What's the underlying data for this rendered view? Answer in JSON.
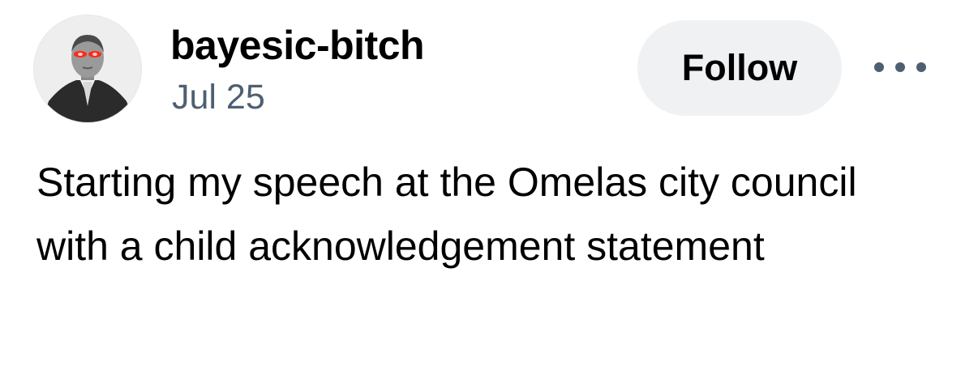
{
  "post": {
    "author": {
      "username": "bayesic-bitch",
      "avatar": "bayes-portrait-red-laser-eyes-avatar"
    },
    "date": "Jul 25",
    "follow_label": "Follow",
    "more_icon": "more-horizontal-icon",
    "text": "Starting my speech at the Omelas city council with a child acknowledgement statement"
  },
  "colors": {
    "text": "#000000",
    "muted": "#4e5f72",
    "button_bg": "#f0f1f3",
    "laser_eyes": "#ff2a1a"
  }
}
